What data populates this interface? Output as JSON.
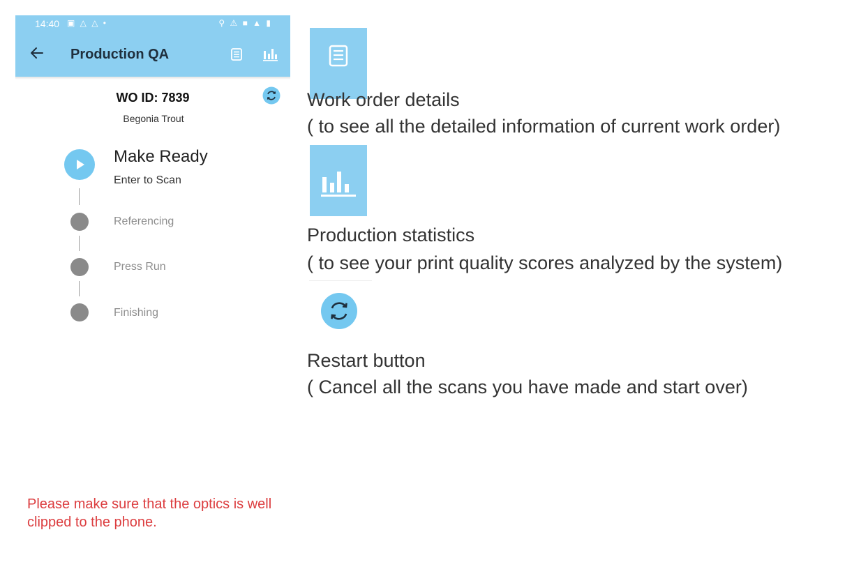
{
  "status_bar": {
    "time": "14:40"
  },
  "app_bar": {
    "title": "Production QA"
  },
  "work_order": {
    "id_label": "WO ID: 7839",
    "name": "Begonia Trout"
  },
  "steps": [
    {
      "title": "Make Ready",
      "subtitle": "Enter to Scan",
      "state": "active"
    },
    {
      "title": "Referencing",
      "state": "pending"
    },
    {
      "title": "Press Run",
      "state": "pending"
    },
    {
      "title": "Finishing",
      "state": "pending"
    }
  ],
  "legend": [
    {
      "icon": "work-order-details-icon",
      "title": "Work order details",
      "description": "( to see all the detailed information of current work order)"
    },
    {
      "icon": "production-statistics-icon",
      "title": "Production statistics",
      "description": "( to see your print quality scores analyzed by the system)"
    },
    {
      "icon": "restart-icon",
      "title": "Restart button",
      "description": "( Cancel all the scans you have made and start over)"
    }
  ],
  "warning": "Please make sure that the optics is well clipped to the phone.",
  "colors": {
    "accent": "#8ccff1",
    "step_active": "#74c8f0",
    "step_pending": "#8a8a8a",
    "warning": "#dc3d3f"
  }
}
